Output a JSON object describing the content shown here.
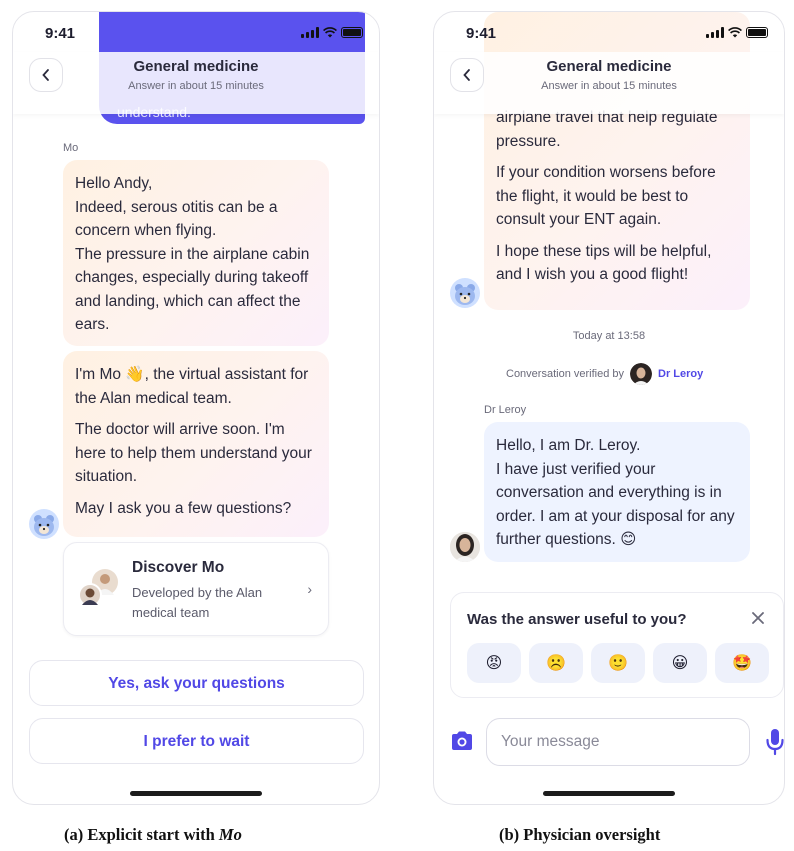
{
  "status": {
    "time": "9:41"
  },
  "header": {
    "title": "General medicine",
    "subtitle": "Answer in about 15 minutes"
  },
  "panel_a": {
    "top_bubble_fragment": "understand.",
    "bot_name": "Mo",
    "message1": "Hello Andy,\nIndeed, serous otitis can be a concern when flying.\nThe pressure in the airplane cabin changes, especially during takeoff and landing, which can affect the ears.",
    "message2_intro": "I'm Mo",
    "message2_wave": "👋",
    "message2_rest": ", the virtual assistant for the Alan medical team.",
    "message2_p2": "The doctor will arrive soon. I'm here to help them understand your situation.",
    "message2_p3": "May I ask you a few questions?",
    "card": {
      "title": "Discover Mo",
      "description": "Developed by the Alan medical team",
      "chevron": "›"
    },
    "buttons": {
      "yes": "Yes, ask your questions",
      "wait": "I prefer to wait"
    }
  },
  "panel_b": {
    "bot_p1_fragment": "airplane travel that help regulate pressure.",
    "bot_p2": "If your condition worsens before the flight, it would be best to consult your ENT again.",
    "bot_p3": "I hope these tips will be helpful, and I wish you a good flight!",
    "timestamp": "Today at 13:58",
    "verified_label": "Conversation verified by",
    "doctor": "Dr Leroy",
    "doctor_sender": "Dr Leroy",
    "doctor_message": "Hello, I am Dr. Leroy.\nI have just verified your conversation and everything is in order. I am at your disposal for any further questions.",
    "doctor_emoji": "😊",
    "feedback": {
      "question": "Was the answer useful to you?",
      "emojis": [
        "😡",
        "☹️",
        "🙂",
        "😀",
        "🤩"
      ]
    },
    "composer": {
      "placeholder": "Your message"
    }
  },
  "captions": {
    "a_prefix": "(a) Explicit start with",
    "a_name": "Mo",
    "b": "(b) Physician oversight"
  },
  "colors": {
    "accent": "#5148e6",
    "user_bubble": "#5a52ee"
  }
}
